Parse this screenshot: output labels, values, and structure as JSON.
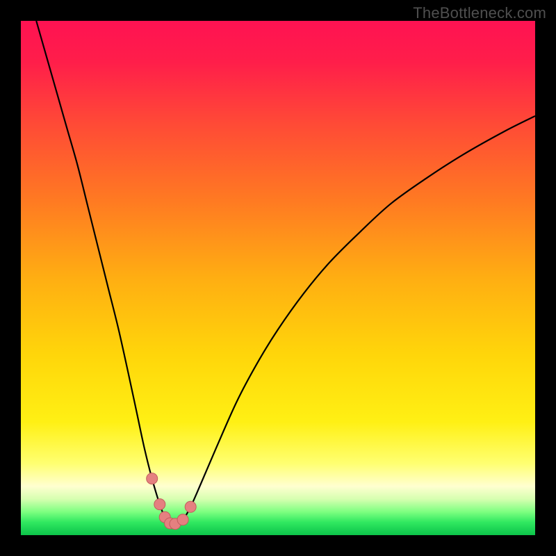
{
  "watermark": "TheBottleneck.com",
  "colors": {
    "frame": "#000000",
    "curve": "#000000",
    "marker_fill": "#e58080",
    "marker_stroke": "#c25d5d",
    "gradient_stops": [
      {
        "offset": 0.0,
        "color": "#ff1252"
      },
      {
        "offset": 0.08,
        "color": "#ff1e4a"
      },
      {
        "offset": 0.2,
        "color": "#ff4a36"
      },
      {
        "offset": 0.35,
        "color": "#ff7a22"
      },
      {
        "offset": 0.5,
        "color": "#ffae12"
      },
      {
        "offset": 0.65,
        "color": "#ffd60a"
      },
      {
        "offset": 0.78,
        "color": "#fff014"
      },
      {
        "offset": 0.86,
        "color": "#ffff70"
      },
      {
        "offset": 0.905,
        "color": "#ffffd0"
      },
      {
        "offset": 0.93,
        "color": "#d6ffb0"
      },
      {
        "offset": 0.955,
        "color": "#7cff80"
      },
      {
        "offset": 0.975,
        "color": "#30e860"
      },
      {
        "offset": 1.0,
        "color": "#0cc44a"
      }
    ]
  },
  "chart_data": {
    "type": "line",
    "title": "",
    "xlabel": "",
    "ylabel": "",
    "xlim": [
      0,
      100
    ],
    "ylim": [
      0,
      100
    ],
    "series": [
      {
        "name": "bottleneck-curve",
        "x": [
          3,
          5,
          7,
          9,
          11,
          13,
          15,
          17,
          19,
          21,
          22.5,
          24,
          25.5,
          27,
          28,
          29,
          30,
          31.5,
          33,
          35,
          38,
          42,
          46,
          50,
          55,
          60,
          66,
          72,
          79,
          86,
          94,
          100
        ],
        "y": [
          100,
          93,
          86,
          79,
          72,
          64,
          56,
          48,
          40,
          31,
          24,
          17,
          11,
          6,
          3.5,
          2.3,
          2.2,
          3.0,
          5.5,
          10,
          17,
          26,
          33.5,
          40,
          47,
          53,
          59,
          64.5,
          69.5,
          74,
          78.5,
          81.5
        ]
      }
    ],
    "markers": {
      "name": "highlighted-points",
      "x": [
        25.5,
        27.0,
        28.0,
        29.0,
        30.0,
        31.5,
        33.0
      ],
      "y": [
        11.0,
        6.0,
        3.5,
        2.3,
        2.2,
        3.0,
        5.5
      ]
    }
  }
}
